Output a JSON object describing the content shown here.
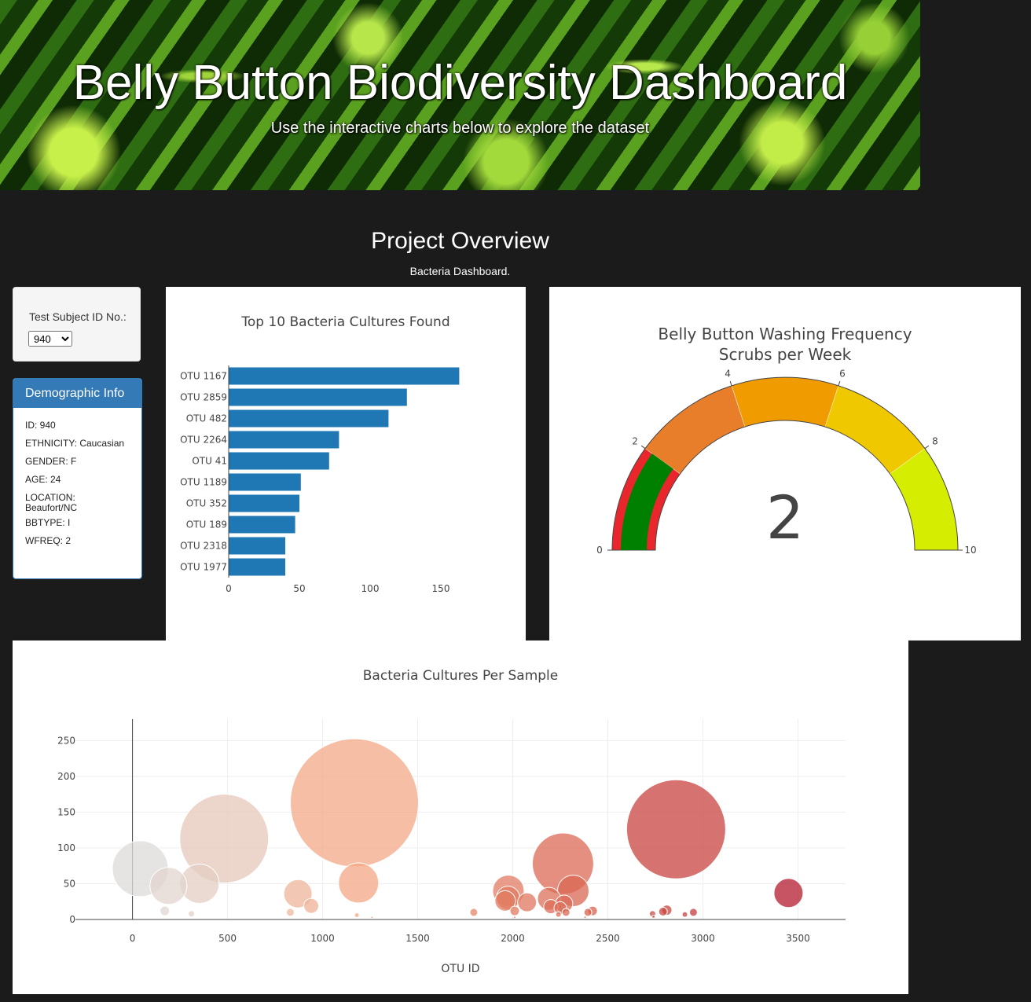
{
  "header": {
    "title": "Belly Button Biodiversity Dashboard",
    "subtitle": "Use the interactive charts below to explore the dataset"
  },
  "overview": {
    "title": "Project Overview",
    "subtitle": "Bacteria Dashboard."
  },
  "selector": {
    "label": "Test Subject ID No.:",
    "selected": "940"
  },
  "demographic": {
    "title": "Demographic Info",
    "rows": [
      "ID: 940",
      "ETHNICITY: Caucasian",
      "GENDER: F",
      "AGE: 24",
      "LOCATION: Beaufort/NC",
      "BBTYPE: I",
      "WFREQ: 2"
    ]
  },
  "bar_chart": {
    "type": "bar",
    "title": "Top 10 Bacteria Cultures Found",
    "categories": [
      "OTU 1167",
      "OTU 2859",
      "OTU 482",
      "OTU 2264",
      "OTU 41",
      "OTU 1189",
      "OTU 352",
      "OTU 189",
      "OTU 2318",
      "OTU 1977"
    ],
    "values": [
      163,
      126,
      113,
      78,
      71,
      51,
      50,
      47,
      40,
      40
    ],
    "xticks": [
      0,
      50,
      100,
      150
    ],
    "xlim": [
      0,
      170
    ],
    "color": "#1f77b4"
  },
  "gauge": {
    "type": "gauge",
    "title_line1": "Belly Button Washing Frequency",
    "title_line2": "Scrubs per Week",
    "value": 2,
    "range": [
      0,
      10
    ],
    "ticks": [
      0,
      2,
      4,
      6,
      8,
      10
    ],
    "bands": [
      {
        "from": 0,
        "to": 2,
        "color": "#e8262b"
      },
      {
        "from": 2,
        "to": 4,
        "color": "#e87e2a"
      },
      {
        "from": 4,
        "to": 6,
        "color": "#f09c00"
      },
      {
        "from": 6,
        "to": 8,
        "color": "#f0c800"
      },
      {
        "from": 8,
        "to": 10,
        "color": "#d4ed00"
      }
    ],
    "bar_color": "#008000"
  },
  "chart_data": {
    "type": "scatter",
    "title": "Bacteria Cultures Per Sample",
    "xlabel": "OTU ID",
    "ylabel": "",
    "xlim": [
      -300,
      3750
    ],
    "ylim": [
      0,
      280
    ],
    "xticks": [
      0,
      500,
      1000,
      1500,
      2000,
      2500,
      3000,
      3500
    ],
    "yticks": [
      0,
      50,
      100,
      150,
      200,
      250
    ],
    "grid": true,
    "points": [
      {
        "x": 41,
        "y": 71
      },
      {
        "x": 189,
        "y": 47
      },
      {
        "x": 352,
        "y": 50
      },
      {
        "x": 482,
        "y": 113
      },
      {
        "x": 1167,
        "y": 163
      },
      {
        "x": 1189,
        "y": 51
      },
      {
        "x": 870,
        "y": 36
      },
      {
        "x": 940,
        "y": 19
      },
      {
        "x": 170,
        "y": 12
      },
      {
        "x": 310,
        "y": 8
      },
      {
        "x": 830,
        "y": 10
      },
      {
        "x": 1795,
        "y": 10
      },
      {
        "x": 1977,
        "y": 40
      },
      {
        "x": 1975,
        "y": 30
      },
      {
        "x": 1960,
        "y": 26
      },
      {
        "x": 2010,
        "y": 12
      },
      {
        "x": 2075,
        "y": 24
      },
      {
        "x": 2264,
        "y": 78
      },
      {
        "x": 2318,
        "y": 40
      },
      {
        "x": 2190,
        "y": 29
      },
      {
        "x": 2200,
        "y": 18
      },
      {
        "x": 2270,
        "y": 22
      },
      {
        "x": 2250,
        "y": 16
      },
      {
        "x": 2280,
        "y": 10
      },
      {
        "x": 2240,
        "y": 7
      },
      {
        "x": 2420,
        "y": 12
      },
      {
        "x": 2395,
        "y": 10
      },
      {
        "x": 2859,
        "y": 126
      },
      {
        "x": 2735,
        "y": 8
      },
      {
        "x": 2790,
        "y": 11
      },
      {
        "x": 2810,
        "y": 13
      },
      {
        "x": 2905,
        "y": 7
      },
      {
        "x": 2950,
        "y": 10
      },
      {
        "x": 3450,
        "y": 37
      },
      {
        "x": 2740,
        "y": 4
      },
      {
        "x": 1180,
        "y": 6
      },
      {
        "x": 1260,
        "y": 3
      },
      {
        "x": 2380,
        "y": 3
      },
      {
        "x": 2010,
        "y": 3
      }
    ]
  }
}
